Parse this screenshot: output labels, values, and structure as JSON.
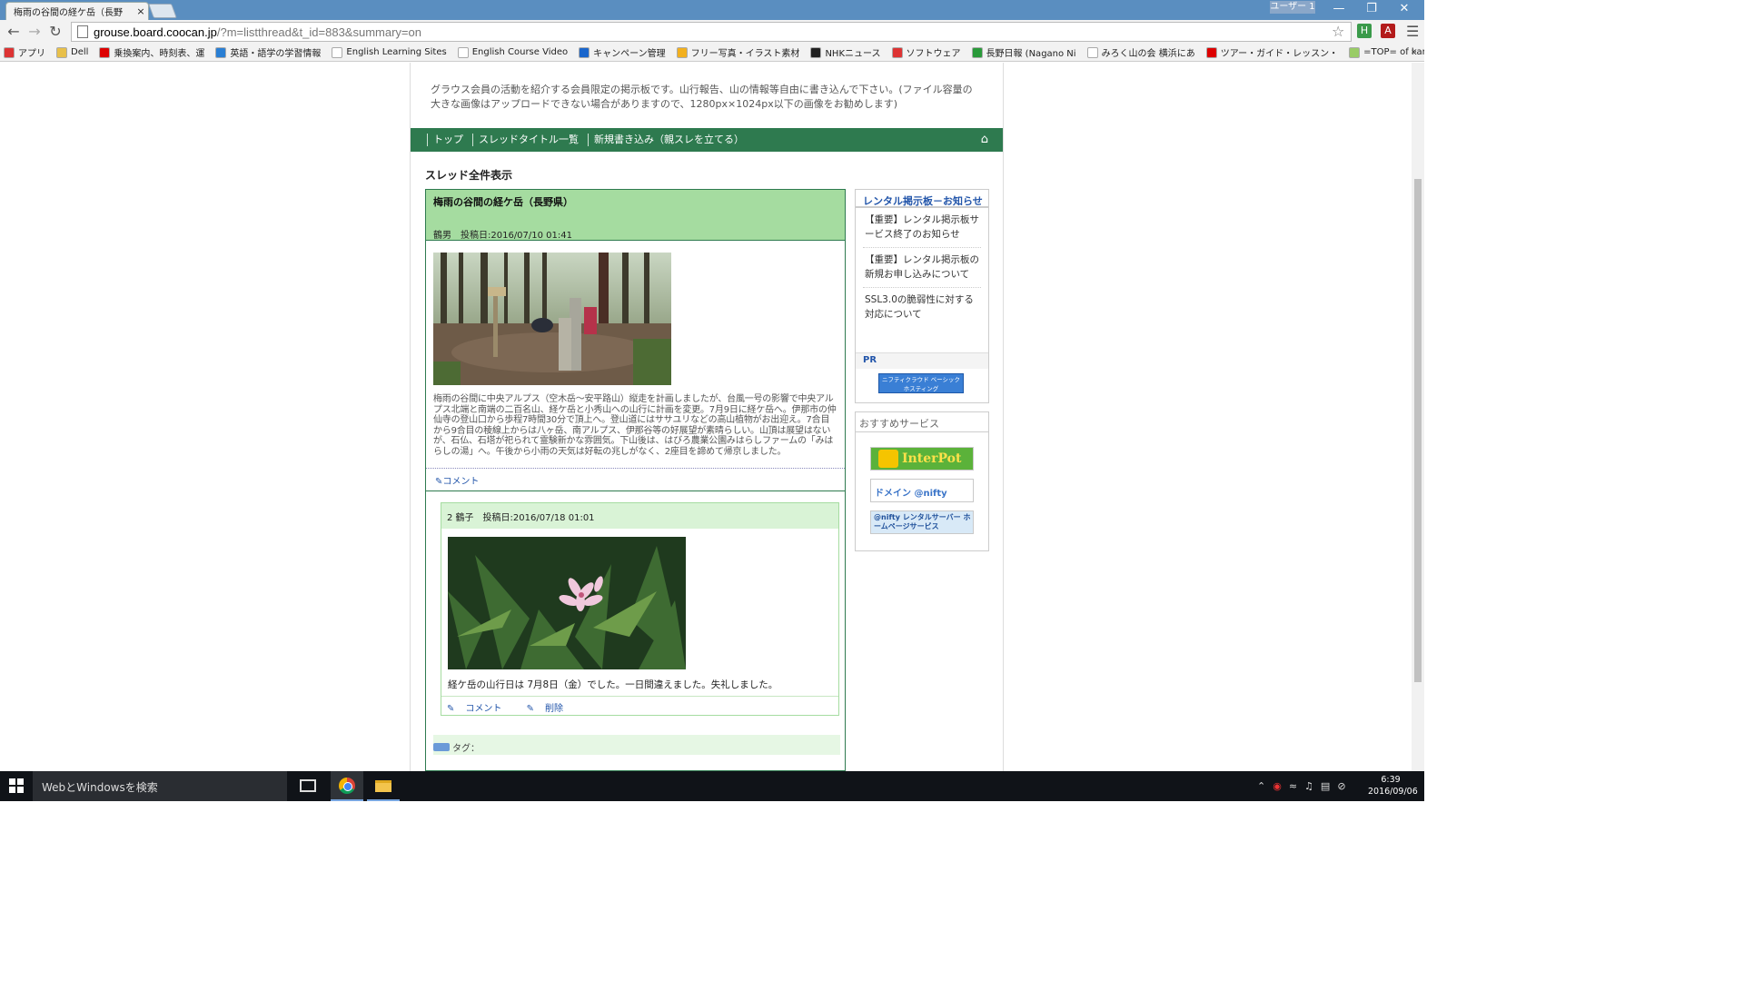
{
  "browser": {
    "tab_title": "梅雨の谷間の経ケ岳（長野",
    "tab_close": "×",
    "user_badge": "ユーザー 1",
    "url_host": "grouse.board.coocan.jp",
    "url_path": "/?m=listthread&t_id=883&summary=on",
    "bookmarks": [
      {
        "label": "アプリ",
        "icon_color": "#d33"
      },
      {
        "label": "Dell",
        "icon_color": "#e8c04a"
      },
      {
        "label": "乗換案内、時刻表、運",
        "icon_color": "#d00"
      },
      {
        "label": "英語・語学の学習情報",
        "icon_color": "#2a7fd4"
      },
      {
        "label": "English Learning Sites",
        "icon_color": "#fff"
      },
      {
        "label": "English Course Video",
        "icon_color": "#fff"
      },
      {
        "label": "キャンペーン管理",
        "icon_color": "#1a66cc"
      },
      {
        "label": "フリー写真・イラスト素材",
        "icon_color": "#f2b01e"
      },
      {
        "label": "NHKニュース",
        "icon_color": "#222"
      },
      {
        "label": "ソフトウェア",
        "icon_color": "#d33"
      },
      {
        "label": "長野日報 (Nagano Ni",
        "icon_color": "#2a9a3a"
      },
      {
        "label": "みろく山の会 横浜にあ",
        "icon_color": "#fff"
      },
      {
        "label": "ツアー・ガイド・レッスン・",
        "icon_color": "#d00"
      },
      {
        "label": "=TOP= of kamoshika",
        "icon_color": "#9c6"
      }
    ]
  },
  "board": {
    "description": "グラウス会員の活動を紹介する会員限定の掲示板です。山行報告、山の情報等自由に書き込んで下さい。(ファイル容量の大きな画像はアップロードできない場合がありますので、1280px×1024px以下の画像をお勧めします)",
    "nav": [
      "トップ",
      "スレッドタイトル一覧",
      "新規書き込み（親スレを立てる）"
    ],
    "section_title": "スレッド全件表示"
  },
  "thread": {
    "title": "梅雨の谷間の経ケ岳（長野県）",
    "meta": "鶴男　投稿日:2016/07/10 01:41",
    "body": "梅雨の谷間に中央アルプス（空木岳〜安平路山）縦走を計画しましたが、台風一号の影響で中央アルプス北端と南端の二百名山、経ケ岳と小秀山への山行に計画を変更。7月9日に経ケ岳へ。伊那市の仲仙寺の登山口から歩程7時間30分で頂上へ。登山道にはササユリなどの高山植物がお出迎え。7合目から9合目の稜線上からは八ヶ岳、南アルプス、伊那谷等の好展望が素晴らしい。山頂は展望はないが、石仏、石塔が祀られて霊験新かな雰囲気。下山後は、はびろ農業公園みはらしファームの「みはらしの湯」へ。午後から小雨の天気は好転の兆しがなく、2座目を諦めて帰京しました。",
    "comment_link": "コメント"
  },
  "reply": {
    "meta": "2 鶴子　投稿日:2016/07/18 01:01",
    "body": "経ケ岳の山行日は 7月8日（金）でした。一日間違えました。失礼しました。",
    "comment_link": "コメント",
    "delete_link": "削除"
  },
  "tags_label": "タグ：",
  "sidebar": {
    "notice_title": "レンタル掲示板－お知らせ",
    "notices": [
      "【重要】レンタル掲示板サービス終了のお知らせ",
      "【重要】レンタル掲示板の新規お申し込みについて",
      "SSL3.0の脆弱性に対する対応について"
    ],
    "pr_label": "PR",
    "pr_banner": "ニフティクラウド ベーシックホスティング",
    "services_title": "おすすめサービス",
    "services": [
      "InterPot",
      "ドメイン @nifty",
      "@nifty レンタルサーバー ホームページサービス"
    ]
  },
  "taskbar": {
    "search_placeholder": "WebとWindowsを検索",
    "time": "6:39",
    "date": "2016/09/06"
  },
  "colors": {
    "nav_green": "#2e7a4f",
    "thread_header_green": "#a5dca0",
    "link_blue": "#2255aa"
  }
}
